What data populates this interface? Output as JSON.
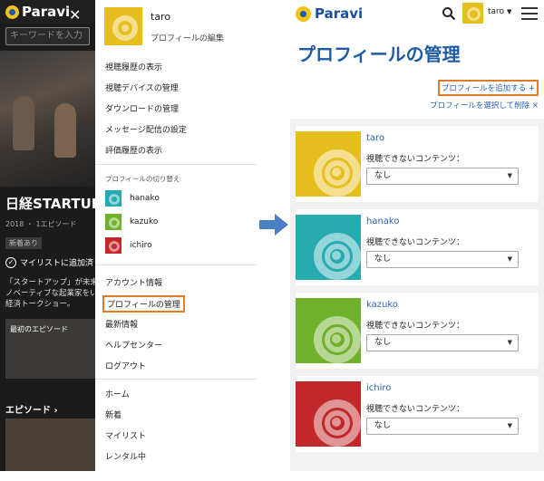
{
  "left": {
    "bg": {
      "brand": "Paravi",
      "search_placeholder": "キーワードを入力",
      "show_title": "日経STARTUP",
      "meta": "2018 ・ 1エピソード",
      "badge": "新着あり",
      "mylist": "マイリストに追加済",
      "desc_line1": "「スタートアップ」が未来",
      "desc_line2": "ノベーティブな起業家をい",
      "desc_line3": "経済トークショー。",
      "latest_episode": "最初のエピソード",
      "episode_section": "エピソード ›"
    },
    "menu": {
      "user": "taro",
      "edit_profile": "プロフィールの編集",
      "items_top": [
        "視聴履歴の表示",
        "視聴デバイスの管理",
        "ダウンロードの管理",
        "メッセージ配信の設定",
        "評価履歴の表示"
      ],
      "switch_caption": "プロフィールの切り替え",
      "switch_profiles": [
        "hanako",
        "kazuko",
        "ichiro"
      ],
      "account": "アカウント情報",
      "profile_manage": "プロフィールの管理",
      "latest_info": "最新情報",
      "help": "ヘルプセンター",
      "logout": "ログアウト",
      "home": "ホーム",
      "new": "新着",
      "mylist": "マイリスト",
      "rental": "レンタル中"
    }
  },
  "right": {
    "brand": "Paravi",
    "user": "taro",
    "page_title": "プロフィールの管理",
    "add_profile": "プロフィールを追加する +",
    "delete_profile": "プロフィールを選択して削除 ×",
    "content_label": "視聴できないコンテンツ：",
    "profiles": [
      {
        "name": "taro",
        "value": "なし",
        "color": "#e6bf1e"
      },
      {
        "name": "hanako",
        "value": "なし",
        "color": "#27aab0"
      },
      {
        "name": "kazuko",
        "value": "なし",
        "color": "#6fb12a"
      },
      {
        "name": "ichiro",
        "value": "なし",
        "color": "#c0282a"
      }
    ]
  },
  "colors": {
    "brand_blue": "#1e5aa5",
    "highlight_orange": "#e07b26",
    "arrow_blue": "#4a7fc4"
  },
  "icons": [
    "close-icon",
    "search-icon",
    "chevron-down-icon",
    "menu-icon",
    "check-circle-icon",
    "arrow-right-icon"
  ]
}
